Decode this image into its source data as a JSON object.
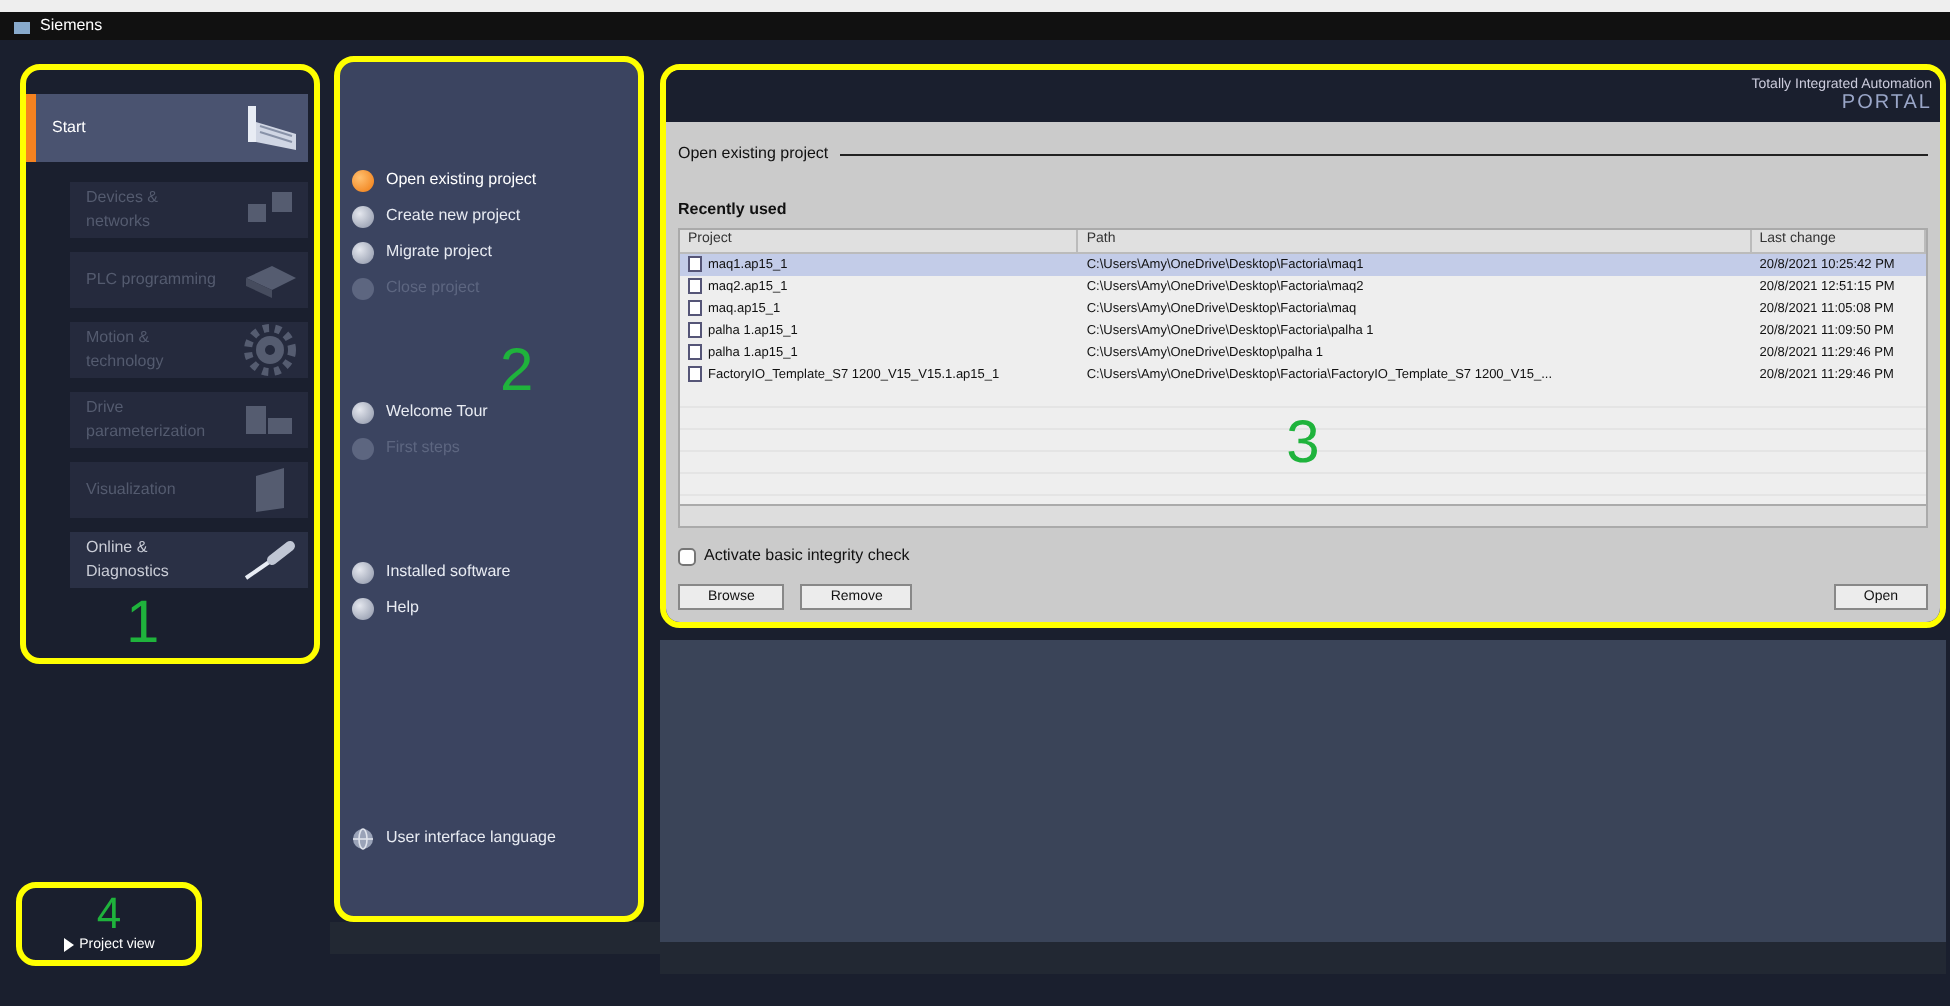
{
  "window": {
    "title": "Siemens"
  },
  "brand": {
    "line1": "Totally Integrated Automation",
    "line2": "PORTAL"
  },
  "portals": {
    "callout": "1",
    "items": [
      {
        "label": "Start",
        "selected": true,
        "disabled": false
      },
      {
        "label": "Devices & networks",
        "selected": false,
        "disabled": true
      },
      {
        "label": "PLC programming",
        "selected": false,
        "disabled": true
      },
      {
        "label": "Motion & technology",
        "selected": false,
        "disabled": true
      },
      {
        "label": "Drive parameterization",
        "selected": false,
        "disabled": true
      },
      {
        "label": "Visualization",
        "selected": false,
        "disabled": true
      },
      {
        "label": "Online & Diagnostics",
        "selected": false,
        "disabled": false
      }
    ]
  },
  "actions": {
    "callout": "2",
    "groups": [
      [
        {
          "label": "Open existing project",
          "selected": true,
          "disabled": false,
          "kind": "bullet"
        },
        {
          "label": "Create new project",
          "selected": false,
          "disabled": false,
          "kind": "bullet"
        },
        {
          "label": "Migrate project",
          "selected": false,
          "disabled": false,
          "kind": "bullet"
        },
        {
          "label": "Close project",
          "selected": false,
          "disabled": true,
          "kind": "bullet"
        }
      ],
      [
        {
          "label": "Welcome Tour",
          "selected": false,
          "disabled": false,
          "kind": "bullet"
        },
        {
          "label": "First steps",
          "selected": false,
          "disabled": true,
          "kind": "bullet"
        }
      ],
      [
        {
          "label": "Installed software",
          "selected": false,
          "disabled": false,
          "kind": "bullet"
        },
        {
          "label": "Help",
          "selected": false,
          "disabled": false,
          "kind": "bullet"
        }
      ],
      [
        {
          "label": "User interface language",
          "selected": false,
          "disabled": false,
          "kind": "globe"
        }
      ]
    ]
  },
  "content": {
    "callout": "3",
    "heading": "Open existing project",
    "subheading": "Recently used",
    "table": {
      "columns": [
        "Project",
        "Path",
        "Last change"
      ],
      "rows": [
        {
          "cells": [
            "maq1.ap15_1",
            "C:\\Users\\Amy\\OneDrive\\Desktop\\Factoria\\maq1",
            "20/8/2021 10:25:42 PM"
          ],
          "selected": true
        },
        {
          "cells": [
            "maq2.ap15_1",
            "C:\\Users\\Amy\\OneDrive\\Desktop\\Factoria\\maq2",
            "20/8/2021 12:51:15 PM"
          ],
          "selected": false
        },
        {
          "cells": [
            "maq.ap15_1",
            "C:\\Users\\Amy\\OneDrive\\Desktop\\Factoria\\maq",
            "20/8/2021 11:05:08 PM"
          ],
          "selected": false
        },
        {
          "cells": [
            "palha 1.ap15_1",
            "C:\\Users\\Amy\\OneDrive\\Desktop\\Factoria\\palha 1",
            "20/8/2021 11:09:50 PM"
          ],
          "selected": false
        },
        {
          "cells": [
            "palha 1.ap15_1",
            "C:\\Users\\Amy\\OneDrive\\Desktop\\palha 1",
            "20/8/2021 11:29:46 PM"
          ],
          "selected": false
        },
        {
          "cells": [
            "FactoryIO_Template_S7 1200_V15_V15.1.ap15_1",
            "C:\\Users\\Amy\\OneDrive\\Desktop\\Factoria\\FactoryIO_Template_S7 1200_V15_...",
            "20/8/2021 11:29:46 PM"
          ],
          "selected": false
        }
      ]
    },
    "integrity_check": {
      "label": "Activate basic integrity check",
      "checked": false
    },
    "buttons_left": [
      "Browse",
      "Remove"
    ],
    "button_right": "Open"
  },
  "footer": {
    "callout": "4",
    "label": "Project view"
  }
}
